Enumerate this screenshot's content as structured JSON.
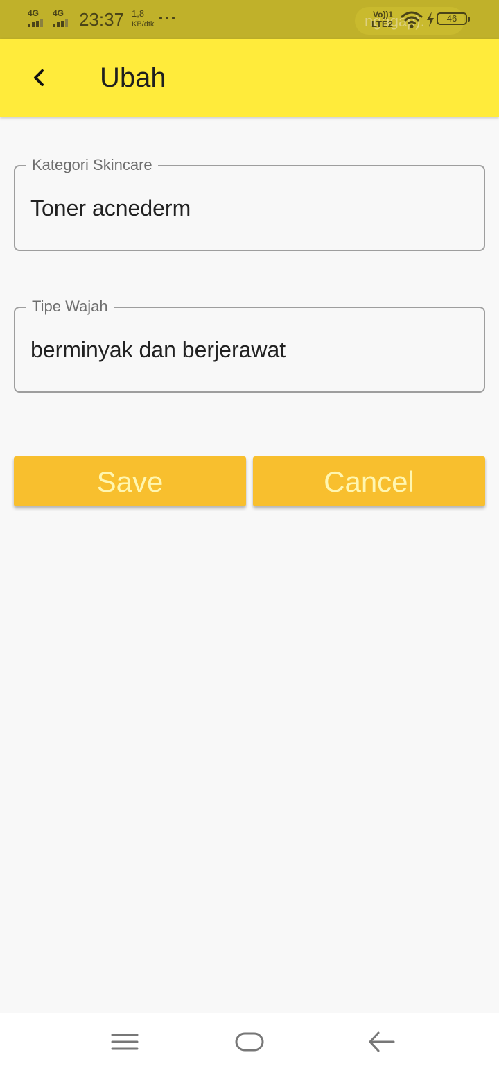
{
  "status_bar": {
    "signal_1": "4G",
    "signal_2": "4G",
    "time": "23:37",
    "net_speed_value": "1,8",
    "net_speed_unit": "KB/dtk",
    "more_dots": "•••",
    "ghost_text": "ngagap).",
    "volte_top": "Vo))1",
    "volte_bottom": "LTE2",
    "battery_level": "46",
    "icons": [
      "signal-icon",
      "signal-icon",
      "more-icon",
      "volte-icon",
      "wifi-icon",
      "charging-icon",
      "battery-icon"
    ]
  },
  "app_bar": {
    "title": "Ubah",
    "back_icon": "chevron-left-icon",
    "background": "#ffeb3b"
  },
  "form": {
    "fields": [
      {
        "label": "Kategori Skincare",
        "value": "Toner acnederm"
      },
      {
        "label": "Tipe Wajah",
        "value": "berminyak dan berjerawat"
      }
    ]
  },
  "actions": {
    "save_label": "Save",
    "cancel_label": "Cancel",
    "button_color": "#f8bf2e",
    "button_text_color": "#fff6b0"
  },
  "nav_bar": {
    "icons": [
      "menu-icon",
      "home-icon",
      "back-arrow-icon"
    ]
  },
  "colors": {
    "status_bar": "#c0b12a",
    "page_background": "#f8f8f8",
    "field_border": "#9e9e9e"
  }
}
